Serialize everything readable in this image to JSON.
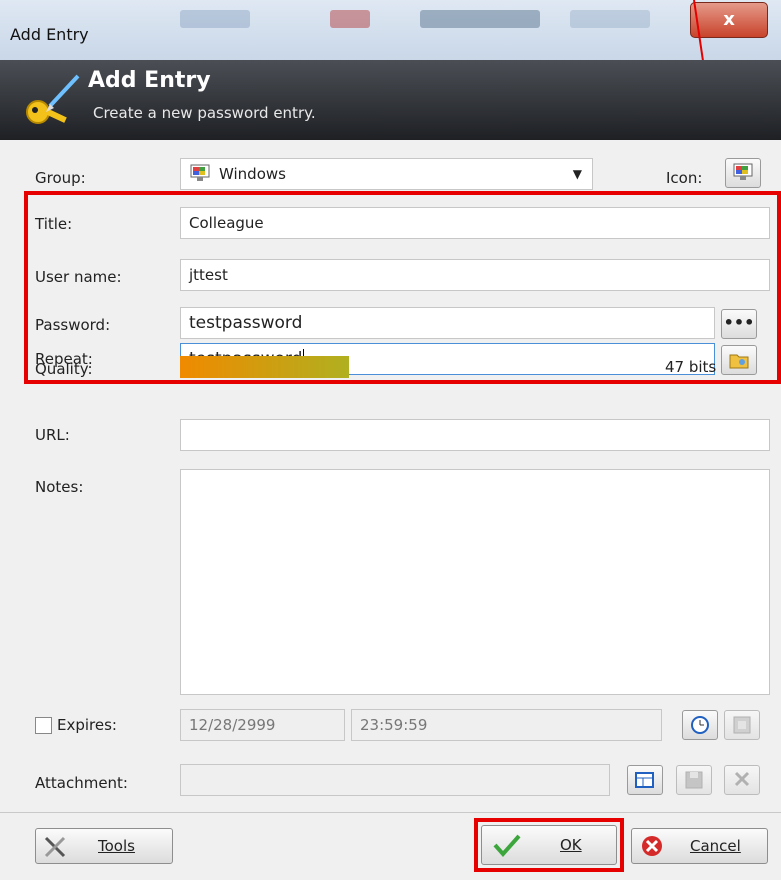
{
  "window": {
    "title": "Add Entry",
    "close_label": "x"
  },
  "header": {
    "title": "Add Entry",
    "subtitle": "Create a new password entry."
  },
  "form": {
    "group_label": "Group:",
    "group_value": "Windows",
    "icon_label": "Icon:",
    "title_label": "Title:",
    "title_value": "Colleague",
    "username_label": "User name:",
    "username_value": "jttest",
    "password_label": "Password:",
    "password_value": "testpassword",
    "repeat_label": "Repeat:",
    "repeat_value": "testpassword",
    "quality_label": "Quality:",
    "quality_bits": "47 bits",
    "quality_fraction": 0.36,
    "url_label": "URL:",
    "url_value": "",
    "notes_label": "Notes:",
    "notes_value": "",
    "expires_label": "Expires:",
    "expires_date": "12/28/2999",
    "expires_time": "23:59:59",
    "attachment_label": "Attachment:",
    "attachment_value": ""
  },
  "buttons": {
    "tools": "Tools",
    "ok": "OK",
    "cancel": "Cancel",
    "password_dots": "•••"
  },
  "colors": {
    "highlight": "#e60000",
    "banner": "#2b2e33",
    "quality_start": "#f08a00",
    "quality_end": "#b0b020"
  }
}
